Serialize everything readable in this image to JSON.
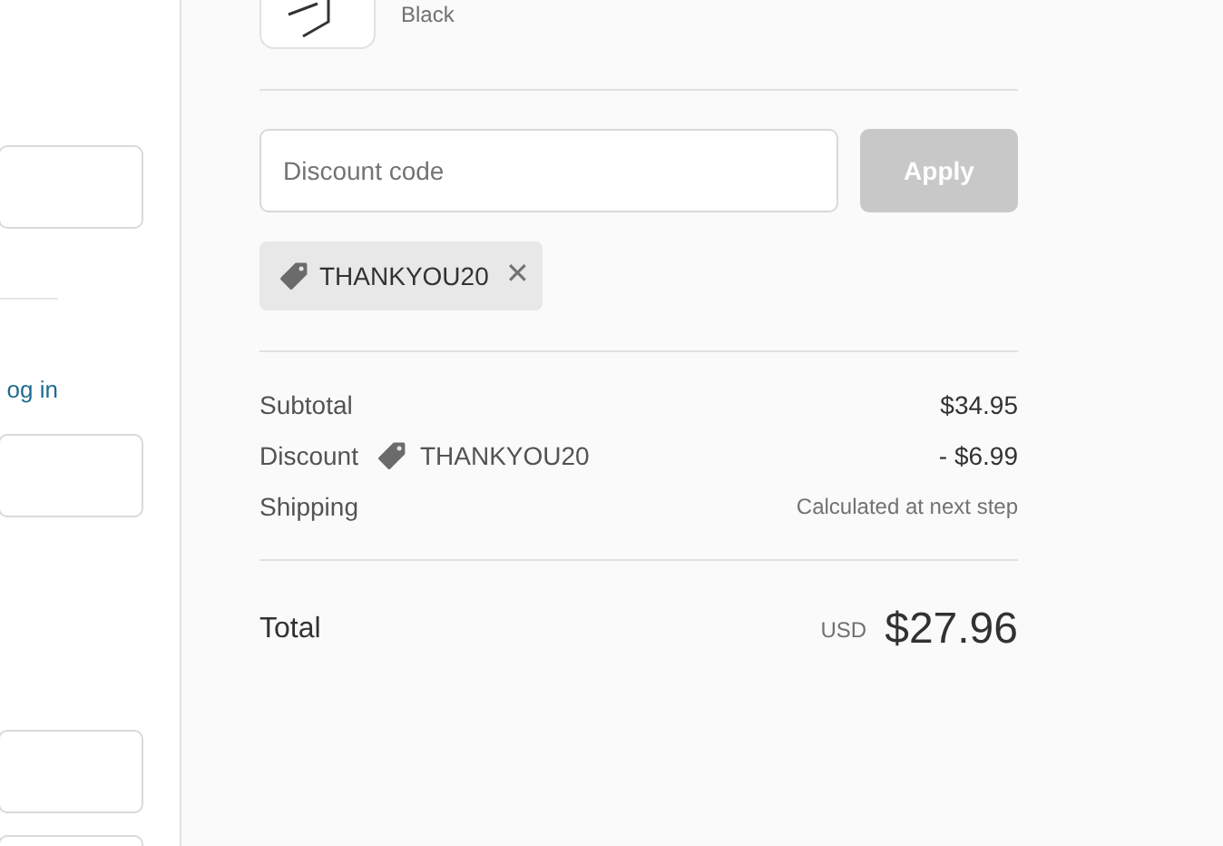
{
  "login_link": "og in",
  "product": {
    "variant": "Black"
  },
  "discount": {
    "placeholder": "Discount code",
    "apply_button": "Apply",
    "apply_disabled": true
  },
  "applied_codes": [
    {
      "code": "THANKYOU20",
      "remove": "✕"
    }
  ],
  "summary": [
    {
      "kind": "plain",
      "label": "Subtotal",
      "value": "$34.95"
    },
    {
      "kind": "code",
      "label": "Discount",
      "code": "THANKYOU20",
      "value": "- $6.99"
    },
    {
      "kind": "note",
      "label": "Shipping",
      "value": "Calculated at next step"
    }
  ],
  "total": {
    "label": "Total",
    "currency": "USD",
    "value": "$27.96"
  }
}
